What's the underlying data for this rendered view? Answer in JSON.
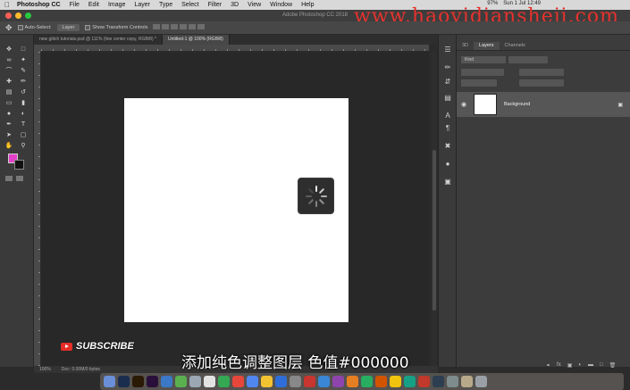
{
  "menubar": {
    "apple": "",
    "items": [
      "Photoshop CC",
      "File",
      "Edit",
      "Image",
      "Layer",
      "Type",
      "Select",
      "Filter",
      "3D",
      "View",
      "Window",
      "Help"
    ],
    "battery": "97%",
    "clock": "Sun 1 Jul 12:49"
  },
  "window": {
    "title": "Adobe Photoshop CC 2018"
  },
  "watermark": "www.haoyidiansheji.com",
  "options_bar": {
    "auto_select_label": "Auto-Select:",
    "auto_select_value": "Layer",
    "show_transform_label": "Show Transform Controls"
  },
  "doc_tabs": [
    "new glitch tutorials.psd @ 111% (line center copy, RGB/8) *",
    "Untitled-1 @ 100% (RGB/8)"
  ],
  "status": {
    "zoom": "100%",
    "doc": "Doc: 0.00M/0 bytes"
  },
  "panels": {
    "tabs": [
      "3D",
      "Layers",
      "Channels"
    ],
    "filter_label": "Kind",
    "layer_name": "Background"
  },
  "subscribe": "SUBSCRIBE",
  "caption": "添加纯色调整图层 色值#000000",
  "colors": {
    "foreground": "#e340c8",
    "background": "#111111",
    "watermark": "#e5322d"
  },
  "icons": {
    "tools": [
      "move-icon",
      "marquee-icon",
      "lasso-icon",
      "magic-wand-icon",
      "crop-icon",
      "eyedropper-icon",
      "healing-brush-icon",
      "brush-icon",
      "clone-stamp-icon",
      "history-brush-icon",
      "eraser-icon",
      "gradient-icon",
      "blur-icon",
      "dodge-icon",
      "pen-icon",
      "type-icon",
      "path-selection-icon",
      "shape-icon",
      "hand-icon",
      "zoom-icon"
    ]
  }
}
